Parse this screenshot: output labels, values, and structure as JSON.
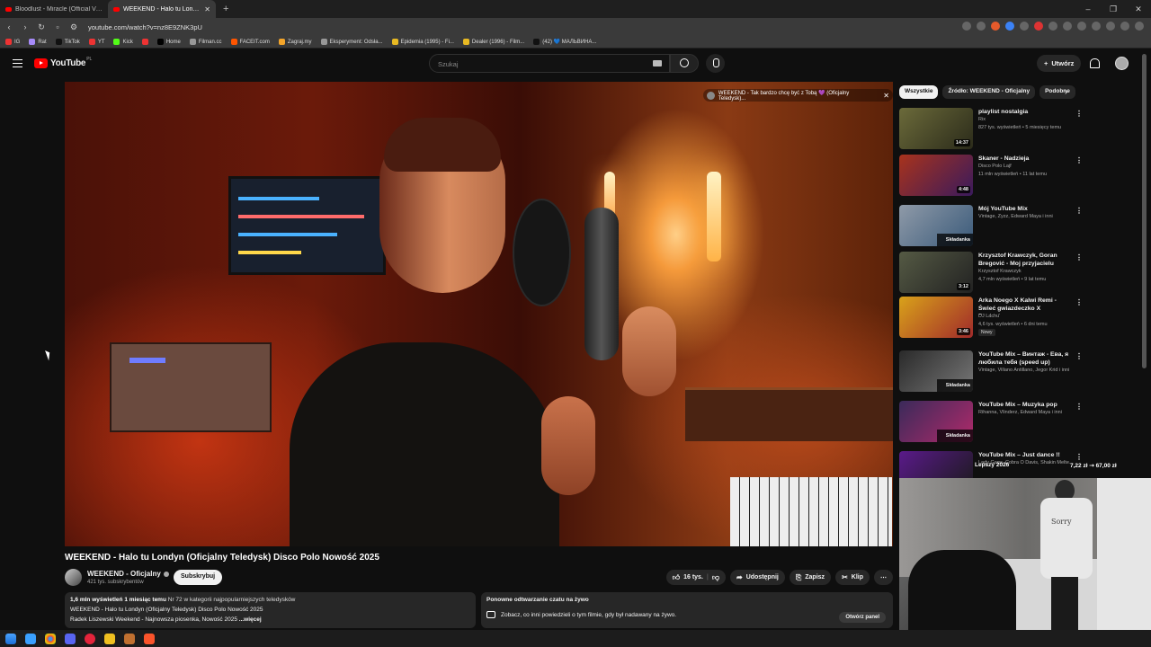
{
  "browser": {
    "tabs": [
      {
        "label": "Bloodlust - Miracle (Official Videoclip)",
        "active": false
      },
      {
        "label": "WEEKEND - Halo tu Londyn (Oficjalny Teledysk)",
        "active": true
      }
    ],
    "new_tab": "+",
    "window_controls": [
      "–",
      "❐",
      "✕"
    ],
    "url": "youtube.com/watch?v=nz8E9ZNK3pU",
    "bookmarks": [
      "IG",
      "Rat",
      "TikTok",
      "YT",
      "Kick",
      "Home",
      "Filman.cc",
      "FACEIT.com",
      "Zagraj.my",
      "Eksperyment: Odsła...",
      "Epidemia (1995) - Fi...",
      "Dealer (1996) - Film...",
      "(42) 💙 МАЛЬВИНА..."
    ]
  },
  "youtube": {
    "logo_text": "YouTube",
    "logo_region": "PL",
    "search_placeholder": "Szukaj",
    "create_label": "Utwórz",
    "create_plus": "+"
  },
  "player": {
    "overlay_title": "WEEKEND - Tak bardzo chcę być z Tobą 💜 (Oficjalny Teledysk)...",
    "overlay_close": "✕"
  },
  "video": {
    "title": "WEEKEND - Halo tu Londyn (Oficjalny Teledysk) Disco Polo Nowość 2025",
    "channel": "WEEKEND - Oficjalny",
    "subscribers": "421 tys. subskrybentów",
    "subscribe_label": "Subskrybuj",
    "likes": "16 tys.",
    "share_label": "Udostępnij",
    "save_label": "Zapisz",
    "clip_label": "Klip",
    "more": "⋯"
  },
  "description": {
    "views_date": "1,6 mln wyświetleń  1 miesiąc temu",
    "rank": "Nr 72 w kategorii najpopularniejszych teledysków",
    "line2": "WEEKEND - Halo tu Londyn (Oficjalny Teledysk) Disco Polo Nowość 2025",
    "line3": "Radek Liszewski Weekend - Najnowsza piosenka, Nowość 2025",
    "more": "...więcej"
  },
  "live_chat": {
    "title": "Ponowne odtwarzanie czatu na żywo",
    "text": "Zobacz, co inni powiedzieli o tym filmie, gdy był nadawany na żywo.",
    "button": "Otwórz panel"
  },
  "chips": [
    "Wszystkie",
    "Źródło: WEEKEND - Oficjalny",
    "Podobne"
  ],
  "recommendations": [
    {
      "title": "playlist nostalgia",
      "channel": "Rix",
      "meta": "827 tys. wyświetleń • 5 miesięcy temu",
      "badge": "14:37",
      "thumb": "#6b6a3a",
      "thumb2": "#2b2b1a"
    },
    {
      "title": "Skaner - Nadzieja",
      "channel": "Disco Polo Lajf",
      "meta": "11 mln wyświetleń • 11 lat temu",
      "badge": "4:48",
      "thumb": "#a8331c",
      "thumb2": "#3a1a5c"
    },
    {
      "title": "Mój YouTube Mix",
      "channel": "Vintage, Zyzz, Edward Maya i inni",
      "meta": "",
      "badge": "Składanka",
      "thumb": "#8f9aa8",
      "thumb2": "#3a5a7a"
    },
    {
      "title": "Krzysztof Krawczyk, Goran Bregović - Moj przyjacielu",
      "channel": "Krzysztof Krawczyk",
      "meta": "4,7 mln wyświetleń • 9 lat temu",
      "badge": "3:12",
      "thumb": "#555a44",
      "thumb2": "#222"
    },
    {
      "title": "Arka Noego X Kalwi Remi - Świeć gwiazdeczko X Explosio...",
      "channel": "DJ Lachu",
      "meta": "4,6 tys. wyświetleń • 6 dni temu",
      "badge": "3:46",
      "thumb": "#d9a21a",
      "thumb2": "#a02a2a",
      "new": "Nowy"
    },
    {
      "title": "YouTube Mix – Винтаж - Ева, я любила тебя (speed up)",
      "channel": "Vintage, Villano Antillano, Jegor Krid i inni",
      "meta": "",
      "badge": "Składanka",
      "thumb": "#2a2a2a",
      "thumb2": "#777"
    },
    {
      "title": "YouTube Mix – Muzyka pop",
      "channel": "Rihanna, Vlinderz, Edward Maya i inni",
      "meta": "",
      "badge": "Składanka",
      "thumb": "#3a2a5a",
      "thumb2": "#b02a6a"
    },
    {
      "title": "YouTube Mix – Just dance !!",
      "channel": "Lady Gaga, Cobra O Davis, Shakin Melte...",
      "meta": "",
      "badge": "",
      "thumb": "#5a1a8a",
      "thumb2": "#1a1a1a"
    }
  ],
  "stream_overlay": {
    "label": "Lepszy 2026",
    "price": "7,22 zł ⇢ 67,00 zł",
    "shirt_text": "Sorry"
  },
  "taskbar": {
    "icons": [
      "windows",
      "explorer",
      "chrome",
      "discord",
      "opera",
      "steam",
      "brave"
    ]
  }
}
